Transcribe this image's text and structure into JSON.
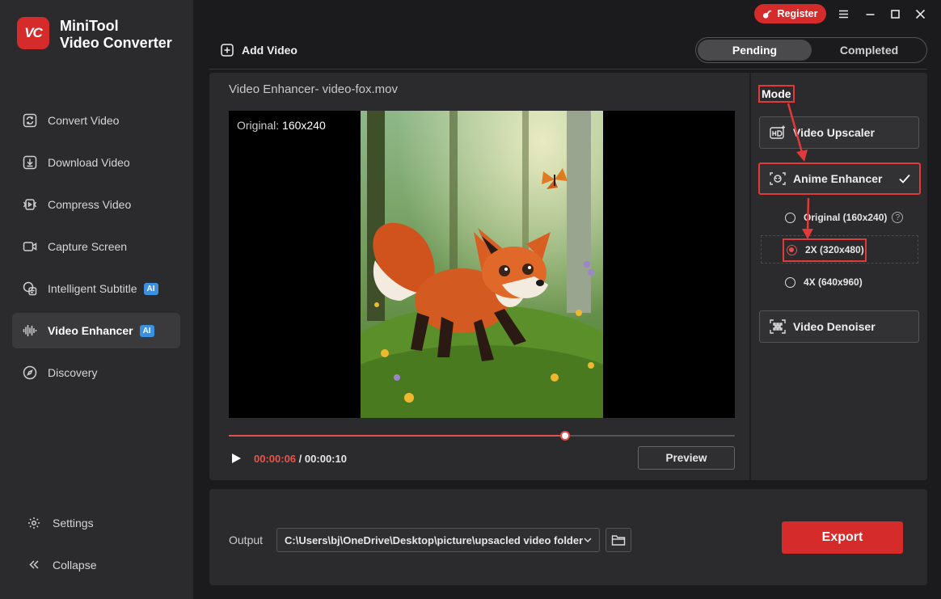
{
  "app": {
    "logo_text": "VC",
    "name_line1": "MiniTool",
    "name_line2": "Video Converter"
  },
  "titlebar": {
    "register_label": "Register"
  },
  "sidebar": {
    "items": [
      {
        "label": "Convert Video",
        "icon": "convert-icon"
      },
      {
        "label": "Download Video",
        "icon": "download-icon"
      },
      {
        "label": "Compress Video",
        "icon": "compress-icon"
      },
      {
        "label": "Capture Screen",
        "icon": "camera-icon"
      },
      {
        "label": "Intelligent Subtitle",
        "icon": "subtitle-icon",
        "badge": "AI"
      },
      {
        "label": "Video Enhancer",
        "icon": "waveform-icon",
        "badge": "AI",
        "active": true
      },
      {
        "label": "Discovery",
        "icon": "compass-icon"
      }
    ],
    "settings_label": "Settings",
    "collapse_label": "Collapse"
  },
  "toolbar": {
    "add_video_label": "Add Video",
    "tab_pending": "Pending",
    "tab_completed": "Completed"
  },
  "player": {
    "title": "Video Enhancer- video-fox.mov",
    "original_prefix": "Original:",
    "original_resolution": "160x240",
    "current_time": "00:00:06",
    "separator": "/",
    "total_time": "00:00:10",
    "progress": 0.665,
    "preview_label": "Preview"
  },
  "mode": {
    "label": "Mode",
    "upscaler_label": "Video Upscaler",
    "anime_label": "Anime Enhancer",
    "options": [
      {
        "label": "Original (160x240)",
        "selected": false
      },
      {
        "label": "2X (320x480)",
        "selected": true
      },
      {
        "label": "4X (640x960)",
        "selected": false
      }
    ],
    "denoiser_label": "Video Denoiser",
    "help_glyph": "?"
  },
  "output": {
    "label": "Output",
    "path": "C:\\Users\\bj\\OneDrive\\Desktop\\picture\\upsacled video folder",
    "export_label": "Export"
  },
  "colors": {
    "accent": "#d52b2b",
    "progress": "#e05050",
    "highlight": "#e03a3a"
  }
}
